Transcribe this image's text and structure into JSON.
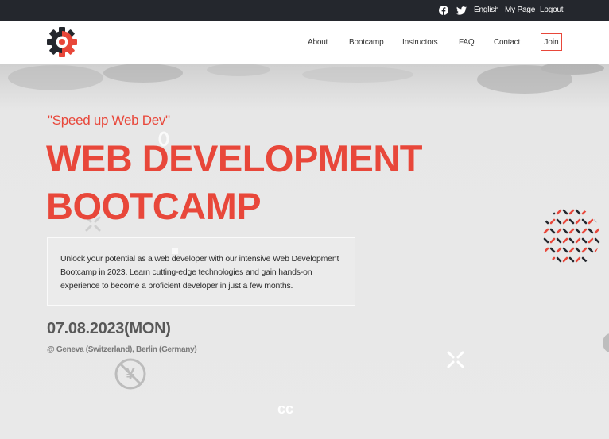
{
  "topbar": {
    "links": {
      "language": "English",
      "mypage": "My Page",
      "logout": "Logout"
    },
    "social_icons": [
      "facebook-icon",
      "twitter-icon"
    ]
  },
  "nav": {
    "items": [
      "About",
      "Bootcamp",
      "Instructors",
      "FAQ",
      "Contact"
    ],
    "join": "Join"
  },
  "hero": {
    "tagline": "\"Speed up Web Dev\"",
    "title_line1": "WEB DEVELOPMENT",
    "title_line2": "BOOTCAMP",
    "description": "Unlock your potential as a web developer with our intensive Web Development Bootcamp in 2023. Learn cutting-edge technologies and gain hands-on experience to become a proficient developer in just a few months.",
    "date": "07.08.2023(MON)",
    "location": "@ Geneva (Switzerland), Berlin (Germany)"
  },
  "colors": {
    "accent": "#e8473a",
    "topbar_bg": "#24272d",
    "text_dark": "#2c2c2c",
    "date_gray": "#585858"
  }
}
